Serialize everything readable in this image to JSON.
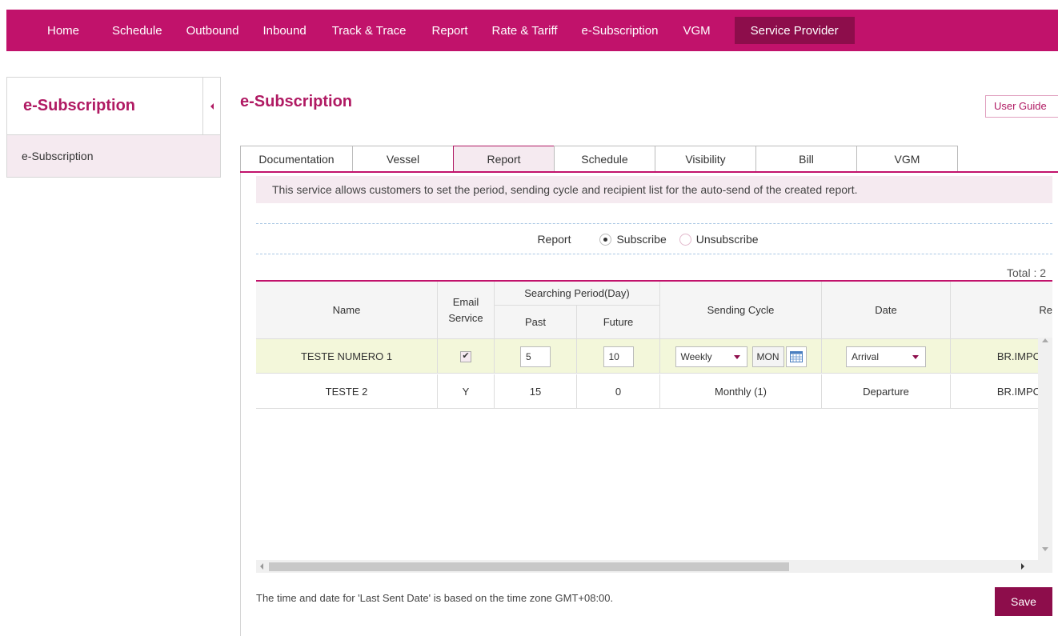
{
  "nav": {
    "items": [
      {
        "label": "Home"
      },
      {
        "label": "Schedule"
      },
      {
        "label": "Outbound"
      },
      {
        "label": "Inbound"
      },
      {
        "label": "Track & Trace"
      },
      {
        "label": "Report"
      },
      {
        "label": "Rate & Tariff"
      },
      {
        "label": "e-Subscription"
      },
      {
        "label": "VGM"
      },
      {
        "label": "Service Provider"
      }
    ],
    "active": "Service Provider"
  },
  "sidebar": {
    "title": "e-Subscription",
    "items": [
      {
        "label": "e-Subscription"
      }
    ]
  },
  "main": {
    "title": "e-Subscription",
    "user_guide": "User Guide",
    "tabs": [
      {
        "label": "Documentation"
      },
      {
        "label": "Vessel"
      },
      {
        "label": "Report"
      },
      {
        "label": "Schedule"
      },
      {
        "label": "Visibility"
      },
      {
        "label": "Bill"
      },
      {
        "label": "VGM"
      }
    ],
    "active_tab": "Report",
    "info": "This service allows customers to set the period, sending cycle and recipient list for the auto-send of the created report.",
    "subscribe": {
      "label": "Report",
      "options": [
        "Subscribe",
        "Unsubscribe"
      ],
      "selected": "Subscribe"
    },
    "total": "Total : 2",
    "table": {
      "headers": {
        "name": "Name",
        "email": "Email Service",
        "period": "Searching Period(Day)",
        "past": "Past",
        "future": "Future",
        "cycle": "Sending Cycle",
        "date": "Date",
        "recipient": "Re"
      },
      "rows": [
        {
          "name": "TESTE NUMERO 1",
          "email": "✔",
          "past": "5",
          "future": "10",
          "cycle": "Weekly",
          "day": "MON",
          "date": "Arrival",
          "recipient": "BR.IMPC"
        },
        {
          "name": "TESTE 2",
          "email": "Y",
          "past": "15",
          "future": "0",
          "cycle": "Monthly (1)",
          "date": "Departure",
          "recipient": "BR.IMPC"
        }
      ]
    },
    "footnote": "The time and date for 'Last Sent Date' is based on the time zone GMT+08:00.",
    "save": "Save"
  },
  "colors": {
    "brand": "#c1126b",
    "brand_dark": "#8d0d4b",
    "highlight": "#f5eaf0",
    "row_selected": "#f3f7da"
  }
}
